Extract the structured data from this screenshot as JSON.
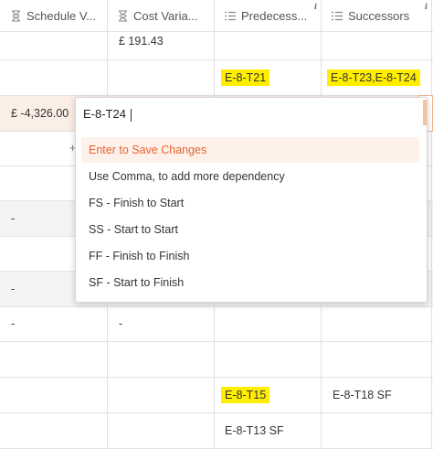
{
  "columns": [
    {
      "label": "Schedule V...",
      "icon": "hourglass-icon"
    },
    {
      "label": "Cost Varia...",
      "icon": "hourglass-icon"
    },
    {
      "label": "Predecess...",
      "icon": "list-icon",
      "info": "i"
    },
    {
      "label": "Successors",
      "icon": "list-icon",
      "info": "i"
    }
  ],
  "rows": {
    "r1": {
      "cost": "£ 191.43"
    },
    "r2": {
      "pred": "E-8-T21",
      "succ": "E-8-T23,E-8-T24"
    },
    "r3": {
      "schedule": "£ -4,326.00"
    },
    "r4": {
      "plus": "+"
    },
    "r6": {
      "schedule": "-"
    },
    "r8": {
      "schedule": "-"
    },
    "r9": {
      "schedule": "-",
      "cost": "-"
    },
    "r11": {
      "pred": "E-8-T15",
      "succ": "E-8-T18 SF"
    },
    "r12": {
      "pred": "E-8-T13 SF"
    }
  },
  "popup": {
    "input_value": "E-8-T24",
    "options": [
      "Enter to Save Changes",
      "Use Comma, to add more dependency",
      "FS - Finish to Start",
      "SS - Start to Start",
      "FF - Finish to Finish",
      "SF - Start to Finish"
    ]
  },
  "colors": {
    "highlight": "#ffee00",
    "accent": "#e8622b",
    "grid": "#e2e2e2"
  }
}
